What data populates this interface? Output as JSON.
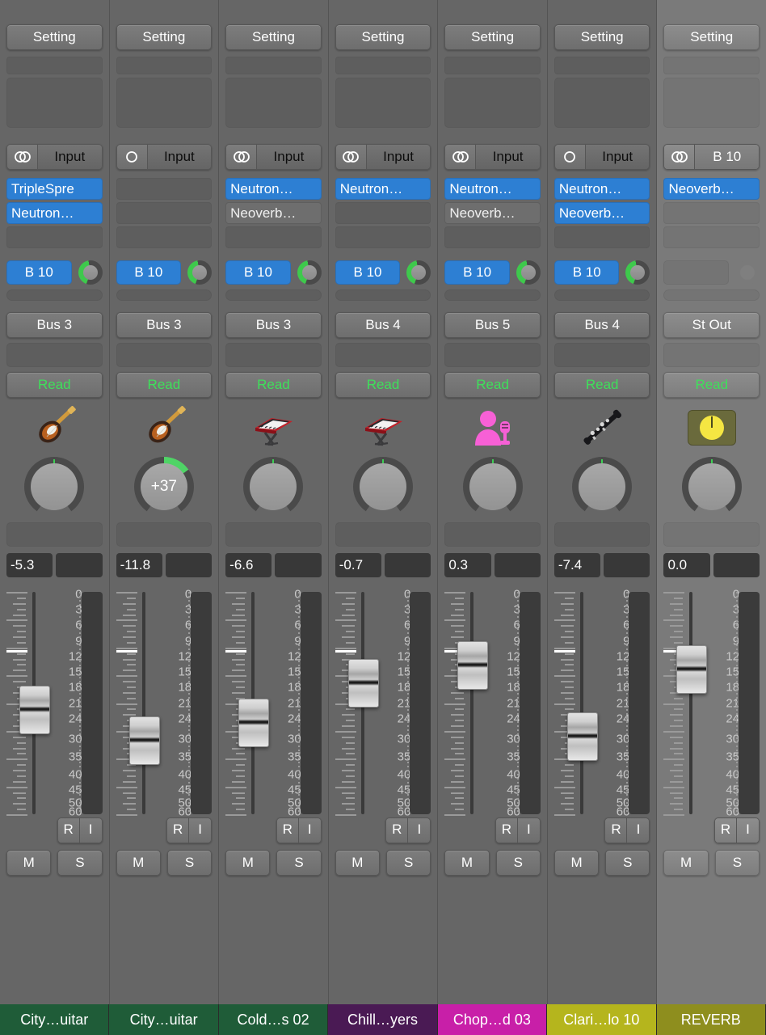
{
  "console": {
    "labels": {
      "setting": "Setting",
      "input": "Input",
      "read": "Read",
      "record_enable": "R",
      "monitor": "I",
      "mute": "M",
      "solo": "S"
    },
    "meter_scale": [
      "0",
      "3",
      "6",
      "9",
      "12",
      "15",
      "18",
      "21",
      "24",
      "30",
      "35",
      "40",
      "45",
      "50",
      "60"
    ],
    "colors": {
      "insert_active": "#2d7fd3",
      "send_active": "#2d7fd3",
      "read_text": "#3ee05a",
      "pan_indicator": "#3ecf55",
      "send_knob_arc": "#3ec94c",
      "channel_bg": "#666666",
      "selected_channel_bg": "#7a7a7a",
      "meter_bg": "#3b3b3b"
    },
    "channels": [
      {
        "name": "City…uitar",
        "name_color": "#1f5c38",
        "setting": "Setting",
        "routing_glyph": "stereo-icon",
        "routing_label": "Input",
        "inserts": [
          {
            "label": "TripleSpre",
            "state": "active"
          },
          {
            "label": "Neutron…",
            "state": "active"
          },
          {
            "label": "",
            "state": "blank"
          }
        ],
        "send": {
          "label": "B 10",
          "state": "active",
          "knob": "on"
        },
        "output": "Bus 3",
        "automation": "Read",
        "instrument_icon": "electric-guitar-icon",
        "pan": {
          "value": "",
          "mode": "center"
        },
        "value_primary": "-5.3",
        "value_secondary": "",
        "fader_position_pct": 42,
        "selected": false
      },
      {
        "name": "City…uitar",
        "name_color": "#1f5c38",
        "setting": "Setting",
        "routing_glyph": "mono-icon",
        "routing_label": "Input",
        "inserts": [
          {
            "label": "",
            "state": "blank"
          },
          {
            "label": "",
            "state": "blank"
          },
          {
            "label": "",
            "state": "blank"
          }
        ],
        "send": {
          "label": "B 10",
          "state": "active",
          "knob": "on"
        },
        "output": "Bus 3",
        "automation": "Read",
        "instrument_icon": "electric-guitar-icon",
        "pan": {
          "value": "+37",
          "mode": "boost"
        },
        "value_primary": "-11.8",
        "value_secondary": "",
        "fader_position_pct": 56,
        "selected": false
      },
      {
        "name": "Cold…s 02",
        "name_color": "#1f5c38",
        "setting": "Setting",
        "routing_glyph": "stereo-icon",
        "routing_label": "Input",
        "inserts": [
          {
            "label": "Neutron…",
            "state": "active"
          },
          {
            "label": "Neoverb…",
            "state": "bypass"
          },
          {
            "label": "",
            "state": "blank"
          }
        ],
        "send": {
          "label": "B 10",
          "state": "active",
          "knob": "on"
        },
        "output": "Bus 3",
        "automation": "Read",
        "instrument_icon": "keyboard-icon",
        "pan": {
          "value": "",
          "mode": "center"
        },
        "value_primary": "-6.6",
        "value_secondary": "",
        "fader_position_pct": 48,
        "selected": false
      },
      {
        "name": "Chill…yers",
        "name_color": "#4a1a54",
        "setting": "Setting",
        "routing_glyph": "stereo-icon",
        "routing_label": "Input",
        "inserts": [
          {
            "label": "Neutron…",
            "state": "active"
          },
          {
            "label": "",
            "state": "blank"
          },
          {
            "label": "",
            "state": "blank"
          }
        ],
        "send": {
          "label": "B 10",
          "state": "active",
          "knob": "on"
        },
        "output": "Bus 4",
        "automation": "Read",
        "instrument_icon": "keyboard-icon",
        "pan": {
          "value": "",
          "mode": "center"
        },
        "value_primary": "-0.7",
        "value_secondary": "",
        "fader_position_pct": 30,
        "selected": false
      },
      {
        "name": "Chop…d 03",
        "name_color": "#c81fa8",
        "setting": "Setting",
        "routing_glyph": "stereo-icon",
        "routing_label": "Input",
        "inserts": [
          {
            "label": "Neutron…",
            "state": "active"
          },
          {
            "label": "Neoverb…",
            "state": "bypass"
          },
          {
            "label": "",
            "state": "blank"
          }
        ],
        "send": {
          "label": "B 10",
          "state": "active",
          "knob": "on"
        },
        "output": "Bus 5",
        "automation": "Read",
        "instrument_icon": "vocalist-icon",
        "pan": {
          "value": "",
          "mode": "center"
        },
        "value_primary": "0.3",
        "value_secondary": "",
        "fader_position_pct": 22,
        "selected": false
      },
      {
        "name": "Clari…lo 10",
        "name_color": "#b5b51d",
        "setting": "Setting",
        "routing_glyph": "mono-icon",
        "routing_label": "Input",
        "inserts": [
          {
            "label": "Neutron…",
            "state": "active"
          },
          {
            "label": "Neoverb…",
            "state": "active"
          },
          {
            "label": "",
            "state": "blank"
          }
        ],
        "send": {
          "label": "B 10",
          "state": "active",
          "knob": "on"
        },
        "output": "Bus 4",
        "automation": "Read",
        "instrument_icon": "clarinet-icon",
        "pan": {
          "value": "",
          "mode": "center"
        },
        "value_primary": "-7.4",
        "value_secondary": "",
        "fader_position_pct": 54,
        "selected": false
      },
      {
        "name": "REVERB",
        "name_color": "#8e8e1e",
        "setting": "Setting",
        "routing_glyph": "stereo-icon",
        "routing_label": "B 10",
        "inserts": [
          {
            "label": "Neoverb…",
            "state": "active"
          },
          {
            "label": "",
            "state": "blank"
          },
          {
            "label": "",
            "state": "blank"
          }
        ],
        "send": {
          "label": "",
          "state": "empty",
          "knob": "off"
        },
        "output": "St Out",
        "automation": "Read",
        "instrument_icon": "reverb-knob-icon",
        "pan": {
          "value": "",
          "mode": "center"
        },
        "value_primary": "0.0",
        "value_secondary": "",
        "fader_position_pct": 24,
        "selected": true
      }
    ]
  }
}
